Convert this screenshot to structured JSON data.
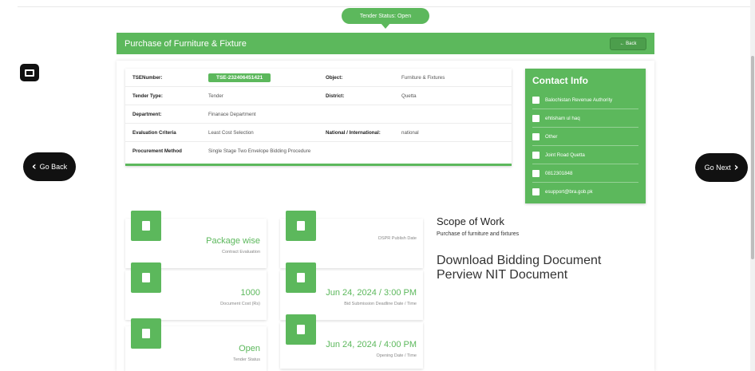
{
  "status_pill": "Tender Status: Open",
  "nav": {
    "back": "Go Back",
    "next": "Go Next"
  },
  "header": {
    "title": "Purchase of Furniture & Fixture",
    "back_button": "← Back"
  },
  "details": {
    "rows": [
      {
        "l1": "TSENumber:",
        "v1": "TSE-232406451421",
        "l2": "Object:",
        "v2": "Furniture & Fixtures"
      },
      {
        "l1": "Tender Type:",
        "v1": "Tender",
        "l2": "District:",
        "v2": "Quetta"
      },
      {
        "l1": "Department:",
        "v1": "Finanace Department",
        "l2": "",
        "v2": ""
      },
      {
        "l1": "Evaluation Criteria",
        "v1": "Least Cost Selection",
        "l2": "National / International:",
        "v2": "national"
      },
      {
        "l1": "Procurement Method",
        "v1": "Single Stage Two Envelope Bidding Procedure",
        "l2": "",
        "v2": ""
      }
    ]
  },
  "contact": {
    "title": "Contact Info",
    "items": [
      {
        "icon": "building-icon",
        "text": "Balochistan Revenue Authority"
      },
      {
        "icon": "person-icon",
        "text": "ehtisham ul haq"
      },
      {
        "icon": "user-card-icon",
        "text": "Other"
      },
      {
        "icon": "home-icon",
        "text": "Joint Road Quetta"
      },
      {
        "icon": "phone-icon",
        "text": "0812301848"
      },
      {
        "icon": "envelope-icon",
        "text": "esupport@bra.gob.pk"
      }
    ]
  },
  "stats": {
    "contract_eval": {
      "value": "Package wise",
      "label": "Contract Evaluation"
    },
    "dspr": {
      "label": "DSPR Publish Date"
    },
    "doc_cost": {
      "value": "1000",
      "label": "Document Cost (Rs)"
    },
    "bid_deadline": {
      "value": "Jun 24, 2024 / 3:00 PM",
      "label": "Bid Submission Deadline Date / Time"
    },
    "tender_status": {
      "value": "Open",
      "label": "Tender Status"
    },
    "opening": {
      "value": "Jun 24, 2024 / 4:00 PM",
      "label": "Opening Date / Time"
    }
  },
  "scope": {
    "title": "Scope of Work",
    "subtitle": "Purchase of furniture and fixtures",
    "links": [
      {
        "text": "Download Bidding Document"
      },
      {
        "text": "Perview NIT Document"
      }
    ]
  },
  "colors": {
    "accent": "#5cb85c",
    "nav": "#111111"
  }
}
